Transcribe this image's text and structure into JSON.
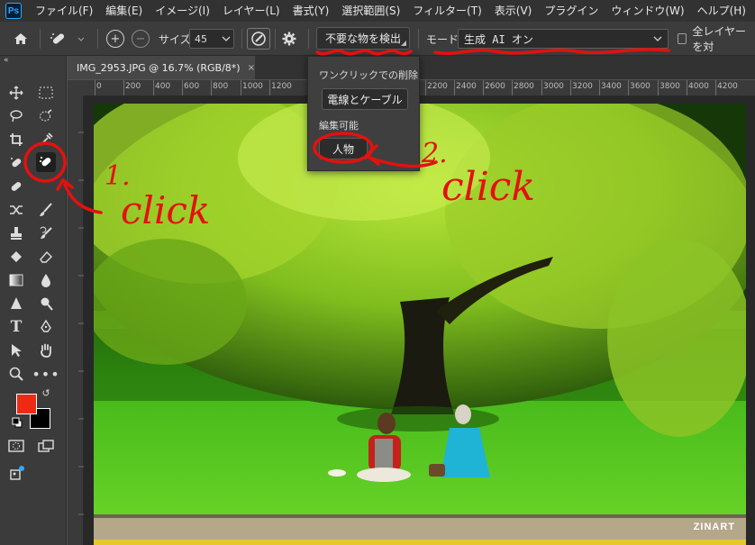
{
  "menu": [
    "ファイル(F)",
    "編集(E)",
    "イメージ(I)",
    "レイヤー(L)",
    "書式(Y)",
    "選択範囲(S)",
    "フィルター(T)",
    "表示(V)",
    "プラグイン",
    "ウィンドウ(W)",
    "ヘルプ(H)"
  ],
  "app_logo": "Ps",
  "options": {
    "size_label": "サイズ",
    "size_value": "45",
    "detect_button": "不要な物を検出",
    "mode_label": "モード",
    "mode_value": "生成 AI オン",
    "all_layers_label": "全レイヤーを対"
  },
  "document": {
    "tab_title": "IMG_2953.JPG @ 16.7% (RGB/8*)",
    "close_glyph": "×"
  },
  "ruler_labels": [
    "0",
    "200",
    "400",
    "600",
    "800",
    "1000",
    "1200",
    "2200",
    "2400",
    "2600",
    "2800",
    "3000",
    "3200",
    "3400",
    "3600",
    "3800",
    "4000",
    "4200"
  ],
  "dropdown": {
    "oneclick_header": "ワンクリックでの削除",
    "wires_button": "電線とケーブル",
    "editable_header": "編集可能",
    "people_button": "人物"
  },
  "annotations": {
    "step1_number": "1.",
    "step1_text": "click",
    "step2_number": "2.",
    "step2_text": "click"
  },
  "watermark": "ZINART",
  "colors": {
    "foreground": "#ee2a15",
    "background": "#000000",
    "annotation": "#e3110f"
  }
}
